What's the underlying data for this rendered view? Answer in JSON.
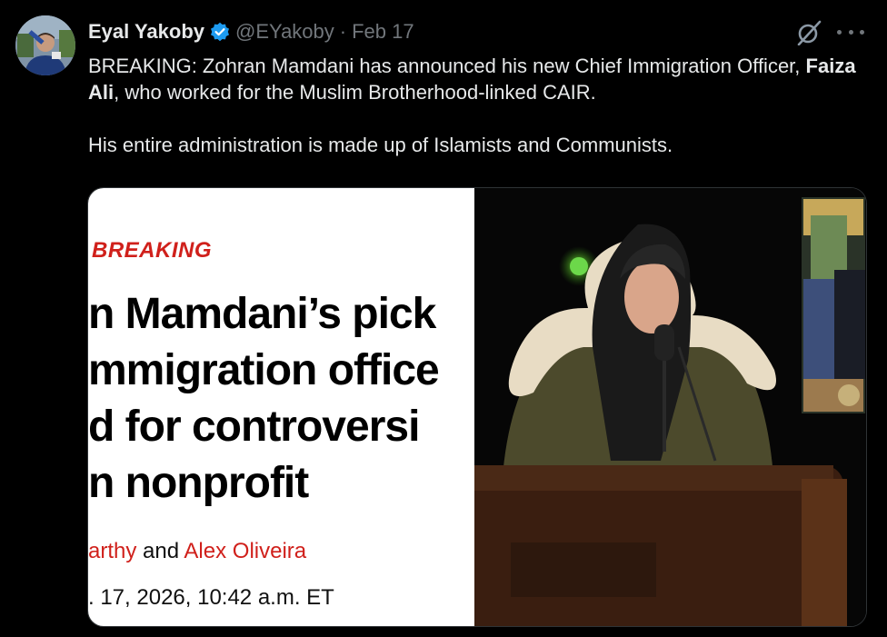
{
  "tweet": {
    "author_name": "Eyal Yakoby",
    "handle": "@EYakoby",
    "separator": "·",
    "date": "Feb 17",
    "text_p1_before": "BREAKING: Zohran Mamdani has announced his new Chief Immigration Officer, ",
    "text_p1_bold": "Faiza Ali",
    "text_p1_after": ", who worked for the Muslim Brotherhood-linked CAIR.",
    "text_p2": "His entire administration is made up of Islamists and Communists."
  },
  "media": {
    "article": {
      "label": "BREAKING",
      "headline_lines": [
        "n Mamdani’s pick",
        "mmigration office",
        "d for controversi",
        "n nonprofit"
      ],
      "byline_partial": "arthy",
      "byline_and": " and ",
      "byline_author2": "Alex Oliveira",
      "timestamp": ". 17, 2026, 10:42 a.m. ET"
    }
  },
  "colors": {
    "accent_red": "#d0201b",
    "verified_blue": "#1d9bf0",
    "muted": "#71767b"
  },
  "icons": [
    "verified-badge-icon",
    "grok-icon",
    "more-options-icon"
  ]
}
